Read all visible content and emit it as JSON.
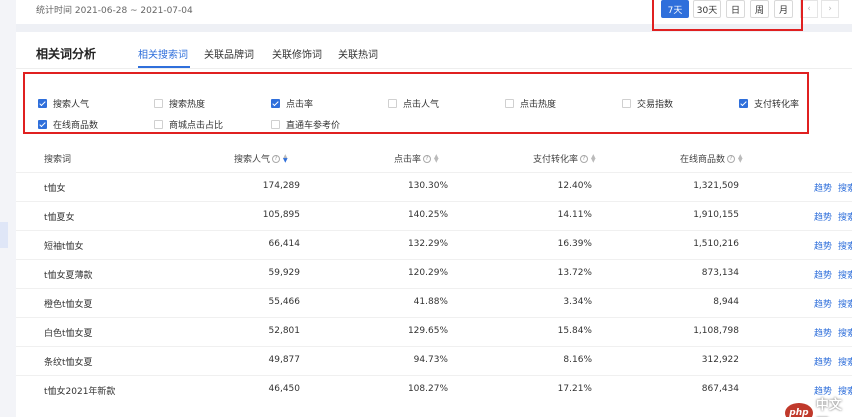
{
  "header": {
    "date_range": "统计时间 2021-06-28 ~ 2021-07-04",
    "periods": [
      "7天",
      "30天",
      "日",
      "周",
      "月"
    ],
    "active_period": "7天",
    "prev_icon": "‹",
    "next_icon": "›"
  },
  "panel": {
    "title": "相关词分析",
    "tabs": [
      "相关搜索词",
      "关联品牌词",
      "关联修饰词",
      "关联热词"
    ],
    "active_tab": "相关搜索词"
  },
  "metric_options": [
    {
      "label": "搜索人气",
      "checked": true
    },
    {
      "label": "搜索热度",
      "checked": false
    },
    {
      "label": "点击率",
      "checked": true
    },
    {
      "label": "点击人气",
      "checked": false
    },
    {
      "label": "点击热度",
      "checked": false
    },
    {
      "label": "交易指数",
      "checked": false
    },
    {
      "label": "支付转化率",
      "checked": true
    },
    {
      "label": "在线商品数",
      "checked": true
    },
    {
      "label": "商城点击占比",
      "checked": false
    },
    {
      "label": "直通车参考价",
      "checked": false
    }
  ],
  "table": {
    "headers": [
      "搜索词",
      "搜索人气",
      "点击率",
      "支付转化率",
      "在线商品数"
    ],
    "actions": [
      "趋势",
      "搜索"
    ],
    "rows": [
      {
        "keyword": "t恤女",
        "popularity": "174,289",
        "ctr": "130.30%",
        "cvr": "12.40%",
        "items": "1,321,509"
      },
      {
        "keyword": "t恤夏女",
        "popularity": "105,895",
        "ctr": "140.25%",
        "cvr": "14.11%",
        "items": "1,910,155"
      },
      {
        "keyword": "短袖t恤女",
        "popularity": "66,414",
        "ctr": "132.29%",
        "cvr": "16.39%",
        "items": "1,510,216"
      },
      {
        "keyword": "t恤女夏薄款",
        "popularity": "59,929",
        "ctr": "120.29%",
        "cvr": "13.72%",
        "items": "873,134"
      },
      {
        "keyword": "橙色t恤女夏",
        "popularity": "55,466",
        "ctr": "41.88%",
        "cvr": "3.34%",
        "items": "8,944"
      },
      {
        "keyword": "白色t恤女夏",
        "popularity": "52,801",
        "ctr": "129.65%",
        "cvr": "15.84%",
        "items": "1,108,798"
      },
      {
        "keyword": "条纹t恤女夏",
        "popularity": "49,877",
        "ctr": "94.73%",
        "cvr": "8.16%",
        "items": "312,922"
      },
      {
        "keyword": "t恤女2021年新款",
        "popularity": "46,450",
        "ctr": "108.27%",
        "cvr": "17.21%",
        "items": "867,434"
      }
    ]
  },
  "watermark": {
    "logo": "php",
    "text": "中文网"
  },
  "colors": {
    "accent": "#2f6fdb",
    "highlight_border": "#e02020"
  }
}
